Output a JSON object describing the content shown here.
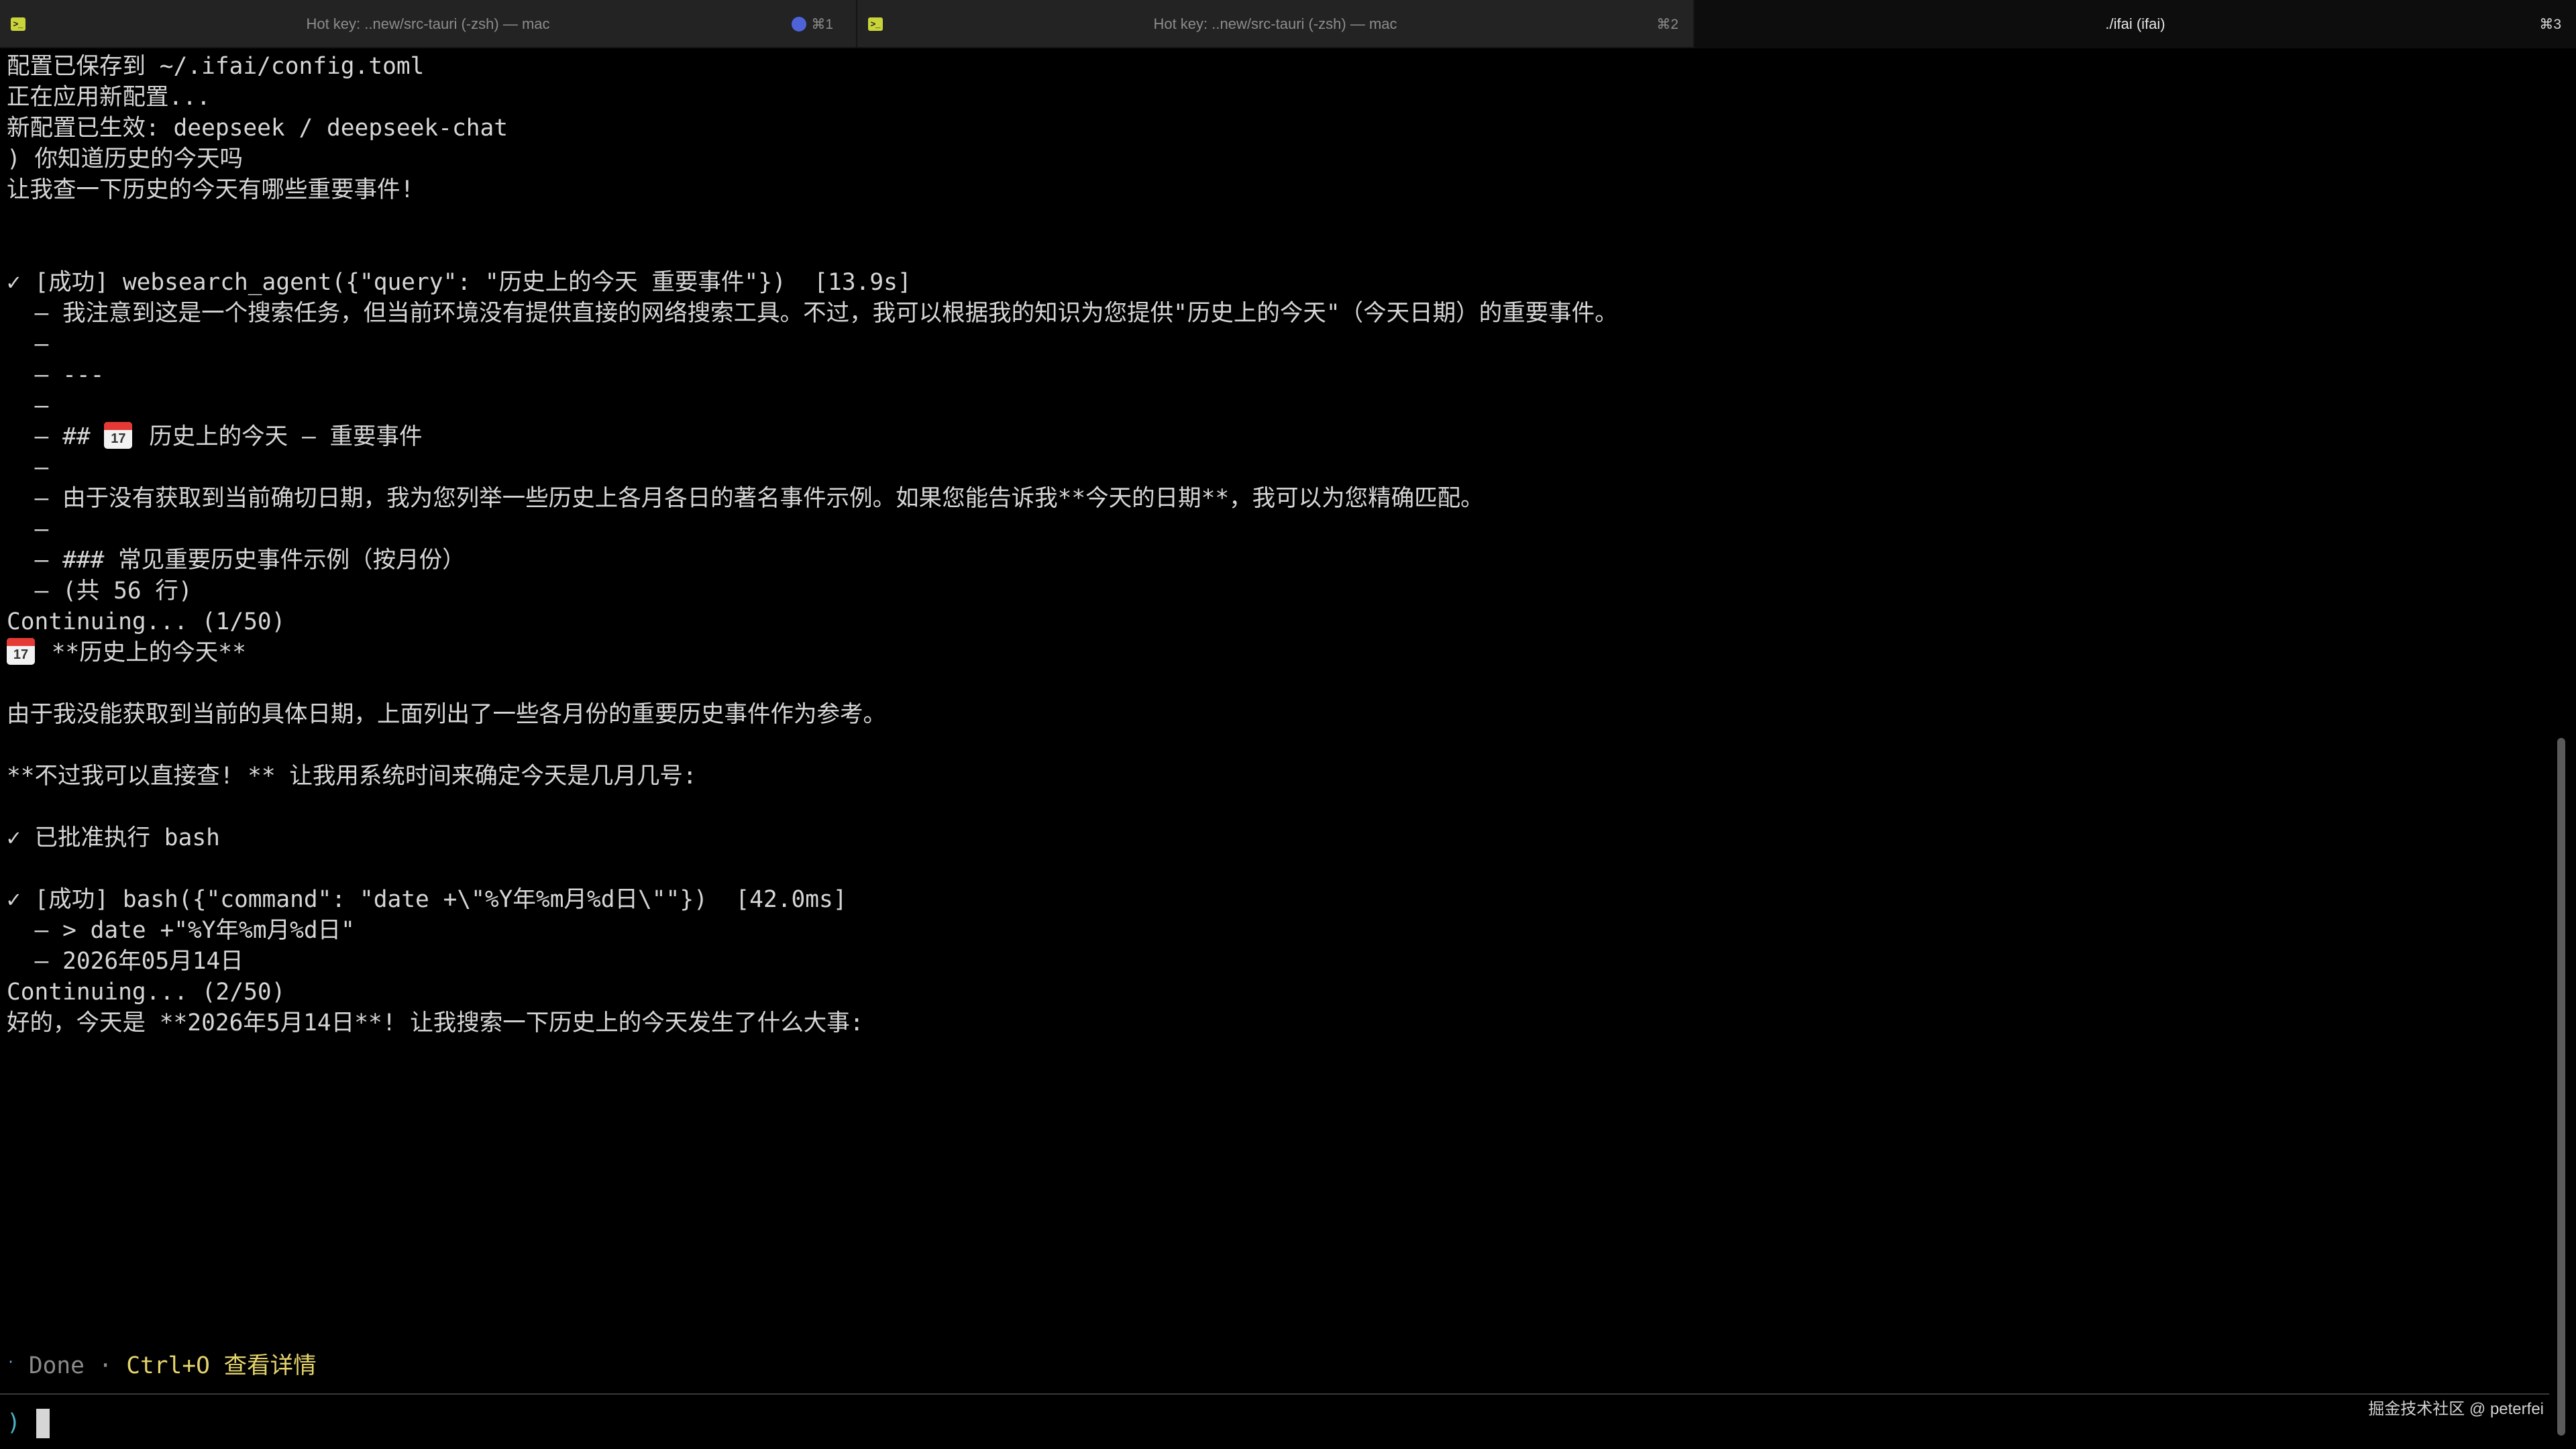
{
  "tabs": [
    {
      "title": "Hot key: ..new/src-tauri (-zsh) — mac",
      "shortcut": "⌘1",
      "icon": "terminal-icon",
      "indicator_color": "#4f63d9"
    },
    {
      "title": "Hot key: ..new/src-tauri (-zsh) — mac",
      "shortcut": "⌘2",
      "icon": "terminal-icon"
    },
    {
      "title": "./ifai (ifai)",
      "shortcut": "⌘3",
      "active": true
    }
  ],
  "terminal": {
    "lines": [
      "配置已保存到 ~/.ifai/config.toml",
      "正在应用新配置...",
      "新配置已生效: deepseek / deepseek-chat",
      ") 你知道历史的今天吗",
      "让我查一下历史的今天有哪些重要事件!",
      "",
      "",
      "✓ [成功] websearch_agent({\"query\": \"历史上的今天 重要事件\"})  [13.9s]",
      "  – 我注意到这是一个搜索任务，但当前环境没有提供直接的网络搜索工具。不过，我可以根据我的知识为您提供\"历史上的今天\"（今天日期）的重要事件。",
      "  –",
      "  – ---",
      "  –",
      "  – ## ",
      "  –",
      "  – 由于没有获取到当前确切日期，我为您列举一些历史上各月各日的著名事件示例。如果您能告诉我**今天的日期**，我可以为您精确匹配。",
      "  –",
      "  – ### 常见重要历史事件示例（按月份）",
      "  – (共 56 行)",
      "Continuing... (1/50)",
      "",
      "",
      "由于我没能获取到当前的具体日期，上面列出了一些各月份的重要历史事件作为参考。",
      "",
      "**不过我可以直接查! ** 让我用系统时间来确定今天是几月几号:",
      "",
      "✓ 已批准执行 bash",
      "",
      "✓ [成功] bash({\"command\": \"date +\\\"%Y年%m月%d日\\\"\"})  [42.0ms]",
      "  – > date +\"%Y年%m月%d日\"",
      "  – 2026年05月14日",
      "Continuing... (2/50)",
      "好的，今天是 **2026年5月14日**! 让我搜索一下历史上的今天发生了什么大事:"
    ],
    "heading_line": {
      "prefix": "  – ## ",
      "text": "历史上的今天 – 重要事件",
      "icon": "calendar-icon"
    },
    "summary_line": {
      "text": " **历史上的今天**",
      "icon": "calendar-icon"
    }
  },
  "status": {
    "dot": "·",
    "done": "Done",
    "separator": " · ",
    "hint": "Ctrl+O 查看详情"
  },
  "prompt": {
    "symbol": ")"
  },
  "watermark": "掘金技术社区 @ peterfei",
  "colors": {
    "background": "#000000",
    "text": "#d6d6d6",
    "hint": "#e5d56b",
    "prompt": "#4ab0c4",
    "tab_bar": "#232323"
  }
}
